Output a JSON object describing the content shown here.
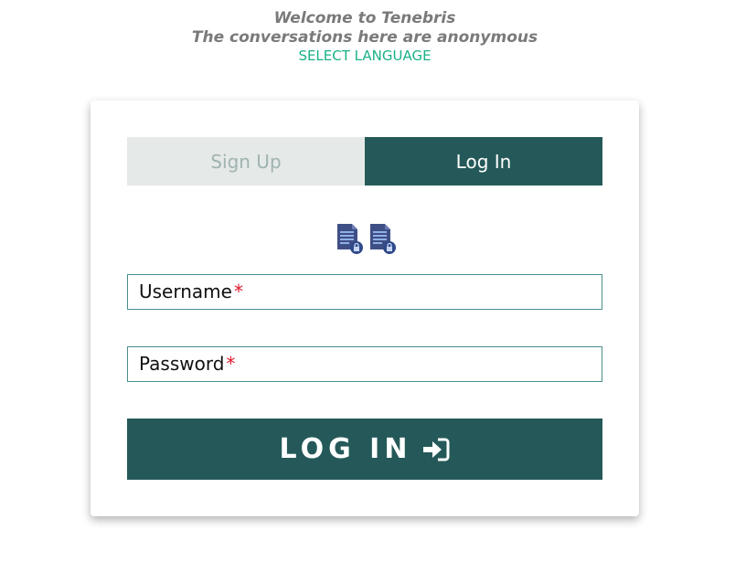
{
  "header": {
    "welcome": "Welcome to Tenebris",
    "subtitle": "The conversations here are anonymous",
    "language_link": "SELECT LANGUAGE"
  },
  "tabs": [
    {
      "label": "Sign Up",
      "active": false
    },
    {
      "label": "Log In",
      "active": true
    }
  ],
  "icons": [
    "secure-document-icon",
    "secure-document-icon"
  ],
  "form": {
    "username_label": "Username",
    "password_label": "Password",
    "required_marker": "*",
    "submit_label": "LOG IN"
  },
  "colors": {
    "primary": "#255959",
    "accent": "#1ab188",
    "inactive_tab_bg": "#e5e9e8",
    "inactive_tab_text": "#a0b3b0",
    "required": "#e0162b"
  }
}
